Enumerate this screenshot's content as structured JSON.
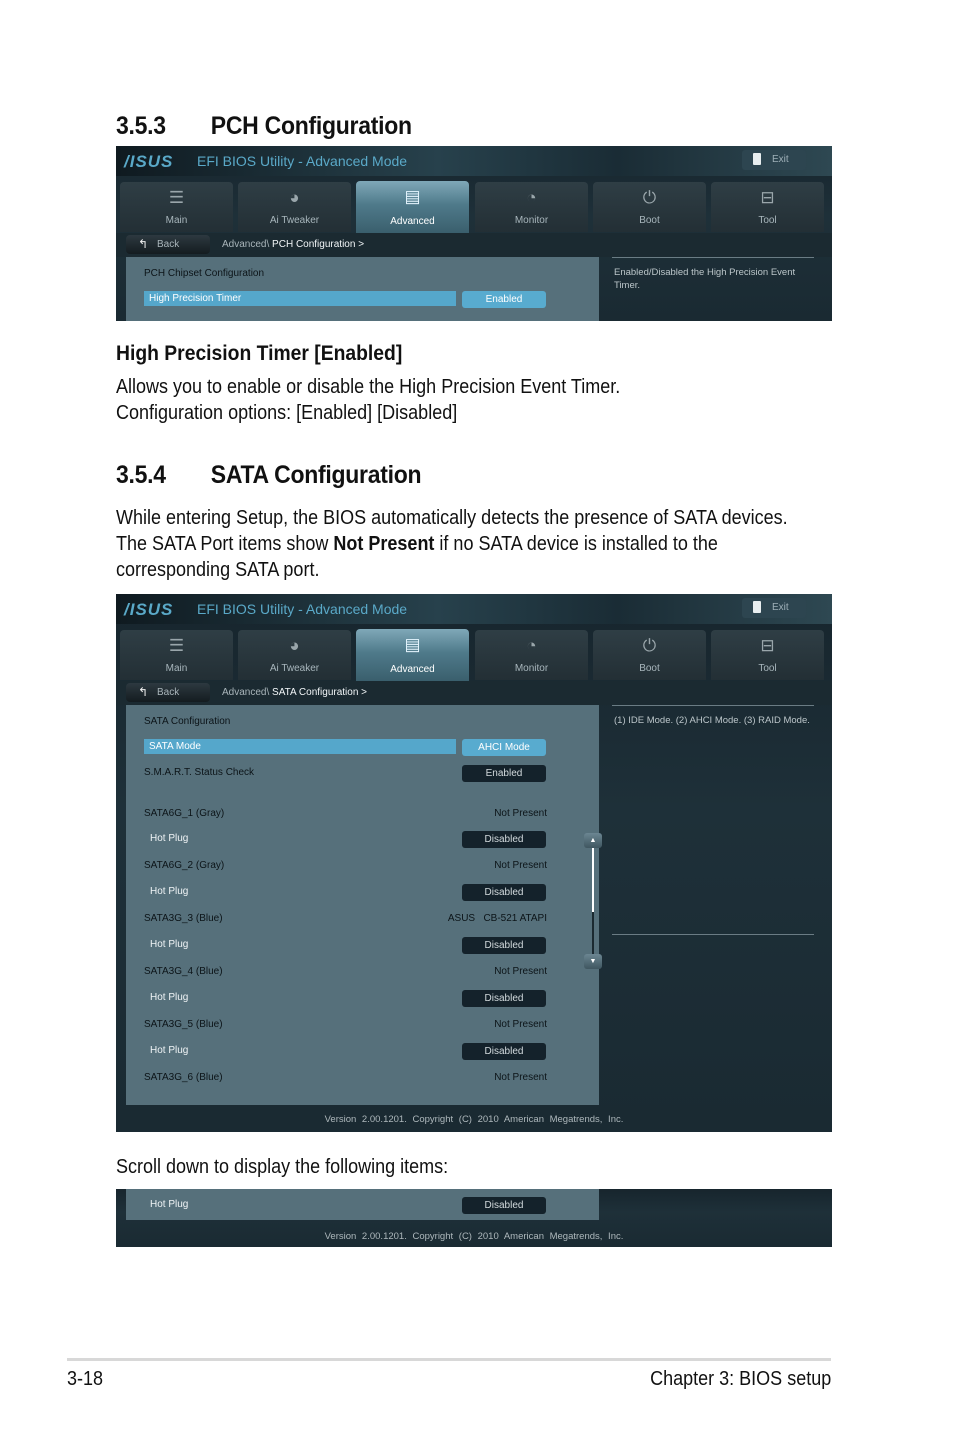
{
  "section_353": {
    "number": "3.5.3",
    "title": "PCH Configuration"
  },
  "bios_common": {
    "logo": "/ISUS",
    "app_title": "EFI BIOS Utility - Advanced Mode",
    "exit_label": "Exit",
    "back_label": "Back",
    "tabs": [
      {
        "label": "Main",
        "icon": "list-icon"
      },
      {
        "label": "Ai  Tweaker",
        "icon": "tweaker-icon"
      },
      {
        "label": "Advanced",
        "icon": "advanced-info-icon",
        "active": true
      },
      {
        "label": "Monitor",
        "icon": "thermometer-icon"
      },
      {
        "label": "Boot",
        "icon": "power-icon"
      },
      {
        "label": "Tool",
        "icon": "toolbox-icon"
      }
    ],
    "version": "Version  2.00.1201.  Copyright  (C)  2010  American  Megatrends,  Inc."
  },
  "pch_screen": {
    "breadcrumb_prefix": "Advanced\\",
    "breadcrumb_current": "PCH Configuration  >",
    "section_label": "PCH Chipset Configuration",
    "item_label": "High Precision Timer",
    "item_value": "Enabled",
    "help": "Enabled/Disabled the High Precision Event Timer."
  },
  "hpt": {
    "heading": "High Precision Timer [Enabled]",
    "line1": "Allows you to enable or disable the High Precision Event Timer.",
    "line2": "Configuration options: [Enabled] [Disabled]"
  },
  "section_354": {
    "number": "3.5.4",
    "title": "SATA Configuration"
  },
  "sata_intro": {
    "line1": "While entering Setup, the BIOS automatically detects the presence of SATA devices.",
    "line2_pre": "The SATA Port items show ",
    "line2_bold": "Not Present",
    "line2_post": " if no SATA device is installed to the",
    "line3": "corresponding SATA port."
  },
  "sata_screen": {
    "breadcrumb_prefix": "Advanced\\",
    "breadcrumb_current": "SATA Configuration  >",
    "section_label": "SATA Configuration",
    "sata_mode_label": "SATA Mode",
    "sata_mode_value": "AHCI Mode",
    "smart_label": "S.M.A.R.T. Status Check",
    "smart_value": "Enabled",
    "ports": [
      {
        "name": "SATA6G_1 (Gray)",
        "status": "Not Present",
        "hot_plug_label": "Hot Plug",
        "hot_plug": "Disabled"
      },
      {
        "name": "SATA6G_2 (Gray)",
        "status": "Not Present",
        "hot_plug_label": "Hot Plug",
        "hot_plug": "Disabled"
      },
      {
        "name": "SATA3G_3 (Blue)",
        "status": "ASUS   CB-521 ATAPI",
        "hot_plug_label": "Hot Plug",
        "hot_plug": "Disabled"
      },
      {
        "name": "SATA3G_4 (Blue)",
        "status": "Not Present",
        "hot_plug_label": "Hot Plug",
        "hot_plug": "Disabled"
      },
      {
        "name": "SATA3G_5 (Blue)",
        "status": "Not Present",
        "hot_plug_label": "Hot Plug",
        "hot_plug": "Disabled"
      },
      {
        "name": "SATA3G_6 (Blue)",
        "status": "Not Present"
      }
    ],
    "help": "(1) IDE Mode. (2) AHCI Mode. (3) RAID Mode.",
    "scroll_position_fraction": 0.6
  },
  "scroll_note": "Scroll down to display the following items:",
  "scrolled_screen": {
    "hot_plug_label": "Hot Plug",
    "hot_plug": "Disabled"
  },
  "footer": {
    "page": "3-18",
    "chapter": "Chapter 3: BIOS setup"
  }
}
